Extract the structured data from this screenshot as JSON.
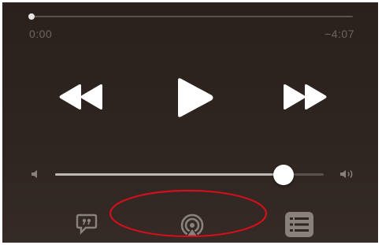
{
  "playback": {
    "elapsed": "0:00",
    "remaining": "−4:07",
    "progress": 0.0
  },
  "controls": {
    "rewind_icon": "rewind-icon",
    "play_icon": "play-icon",
    "forward_icon": "fast-forward-icon"
  },
  "volume": {
    "level": 0.85,
    "low_icon": "volume-low-icon",
    "high_icon": "volume-high-icon"
  },
  "bottom_bar": {
    "lyrics_icon": "lyrics-icon",
    "airplay_icon": "airplay-icon",
    "queue_icon": "queue-list-icon"
  },
  "colors": {
    "background": "#2e2420",
    "icon": "#ffffff",
    "dim_icon": "#8a817d",
    "track": "#5c514c",
    "annotation": "#d0101a"
  }
}
